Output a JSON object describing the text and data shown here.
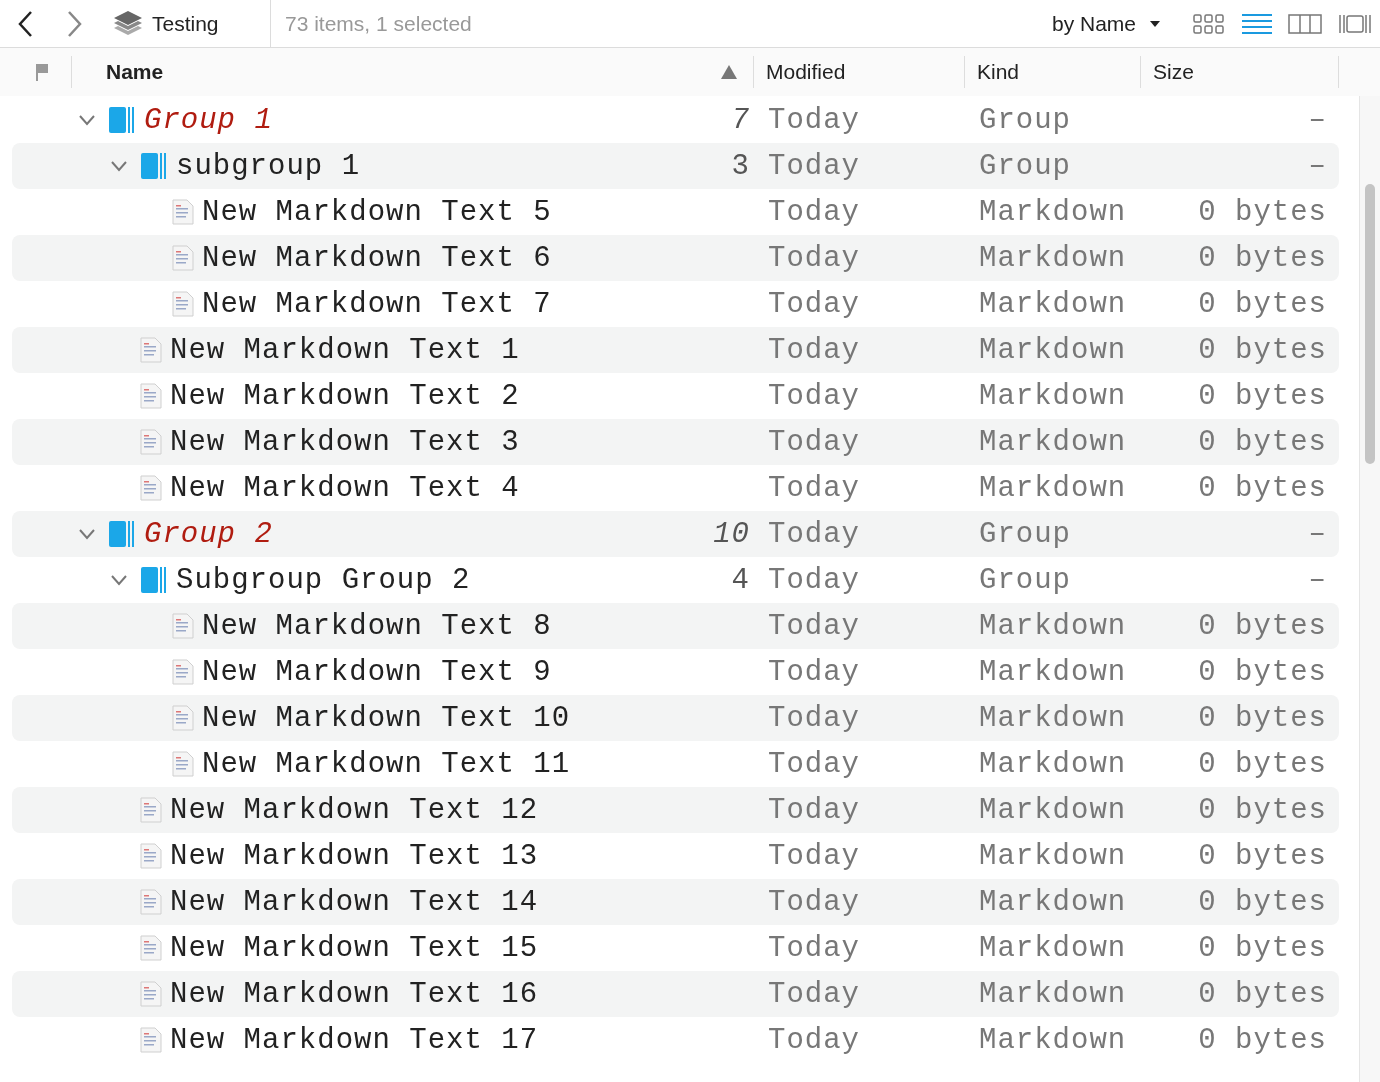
{
  "toolbar": {
    "folder": "Testing",
    "status": "73 items, 1 selected",
    "sort": "by Name",
    "view_modes": [
      {
        "selected": false
      },
      {
        "selected": true
      },
      {
        "selected": false
      },
      {
        "selected": false
      }
    ]
  },
  "columns": [
    {
      "label": "Name",
      "sorted": true
    },
    {
      "label": "Modified",
      "sorted": false
    },
    {
      "label": "Kind",
      "sorted": false
    },
    {
      "label": "Size",
      "sorted": false
    }
  ],
  "rows": [
    {
      "kind": "group",
      "name": "Group 1",
      "count": "7",
      "modified": "Today",
      "type": "Group",
      "size": "–",
      "expanded": true,
      "children": [
        {
          "kind": "group",
          "name": "subgroup 1",
          "count": "3",
          "modified": "Today",
          "type": "Group",
          "size": "–",
          "expanded": true,
          "children": [
            {
              "kind": "file",
              "name": "New Markdown Text 5",
              "modified": "Today",
              "type": "Markdown",
              "size": "0 bytes"
            },
            {
              "kind": "file",
              "name": "New Markdown Text 6",
              "modified": "Today",
              "type": "Markdown",
              "size": "0 bytes"
            },
            {
              "kind": "file",
              "name": "New Markdown Text 7",
              "modified": "Today",
              "type": "Markdown",
              "size": "0 bytes"
            }
          ]
        },
        {
          "kind": "file",
          "name": "New Markdown Text 1",
          "modified": "Today",
          "type": "Markdown",
          "size": "0 bytes"
        },
        {
          "kind": "file",
          "name": "New Markdown Text 2",
          "modified": "Today",
          "type": "Markdown",
          "size": "0 bytes"
        },
        {
          "kind": "file",
          "name": "New Markdown Text 3",
          "modified": "Today",
          "type": "Markdown",
          "size": "0 bytes"
        },
        {
          "kind": "file",
          "name": "New Markdown Text 4",
          "modified": "Today",
          "type": "Markdown",
          "size": "0 bytes"
        }
      ]
    },
    {
      "kind": "group",
      "name": "Group 2",
      "count": "10",
      "modified": "Today",
      "type": "Group",
      "size": "–",
      "expanded": true,
      "children": [
        {
          "kind": "group",
          "name": "Subgroup Group 2",
          "count": "4",
          "modified": "Today",
          "type": "Group",
          "size": "–",
          "expanded": true,
          "children": [
            {
              "kind": "file",
              "name": "New Markdown Text 8",
              "modified": "Today",
              "type": "Markdown",
              "size": "0 bytes"
            },
            {
              "kind": "file",
              "name": "New Markdown Text 9",
              "modified": "Today",
              "type": "Markdown",
              "size": "0 bytes"
            },
            {
              "kind": "file",
              "name": "New Markdown Text 10",
              "modified": "Today",
              "type": "Markdown",
              "size": "0 bytes"
            },
            {
              "kind": "file",
              "name": "New Markdown Text 11",
              "modified": "Today",
              "type": "Markdown",
              "size": "0 bytes"
            }
          ]
        },
        {
          "kind": "file",
          "name": "New Markdown Text 12",
          "modified": "Today",
          "type": "Markdown",
          "size": "0 bytes"
        },
        {
          "kind": "file",
          "name": "New Markdown Text 13",
          "modified": "Today",
          "type": "Markdown",
          "size": "0 bytes"
        },
        {
          "kind": "file",
          "name": "New Markdown Text 14",
          "modified": "Today",
          "type": "Markdown",
          "size": "0 bytes"
        },
        {
          "kind": "file",
          "name": "New Markdown Text 15",
          "modified": "Today",
          "type": "Markdown",
          "size": "0 bytes"
        },
        {
          "kind": "file",
          "name": "New Markdown Text 16",
          "modified": "Today",
          "type": "Markdown",
          "size": "0 bytes"
        },
        {
          "kind": "file",
          "name": "New Markdown Text 17",
          "modified": "Today",
          "type": "Markdown",
          "size": "0 bytes"
        }
      ]
    }
  ]
}
